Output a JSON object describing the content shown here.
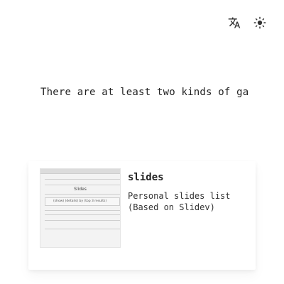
{
  "header": {
    "translate_icon": "translate-icon",
    "theme_icon": "sun-icon"
  },
  "hero": {
    "typing_text": "There are at least two kinds of ga"
  },
  "projects": [
    {
      "title": "slides",
      "description": "Personal slides list (Based on Slidev)",
      "thumbnail": {
        "title": "Slides",
        "subtitle": "(show) (details) by (top 3 results)"
      }
    }
  ]
}
